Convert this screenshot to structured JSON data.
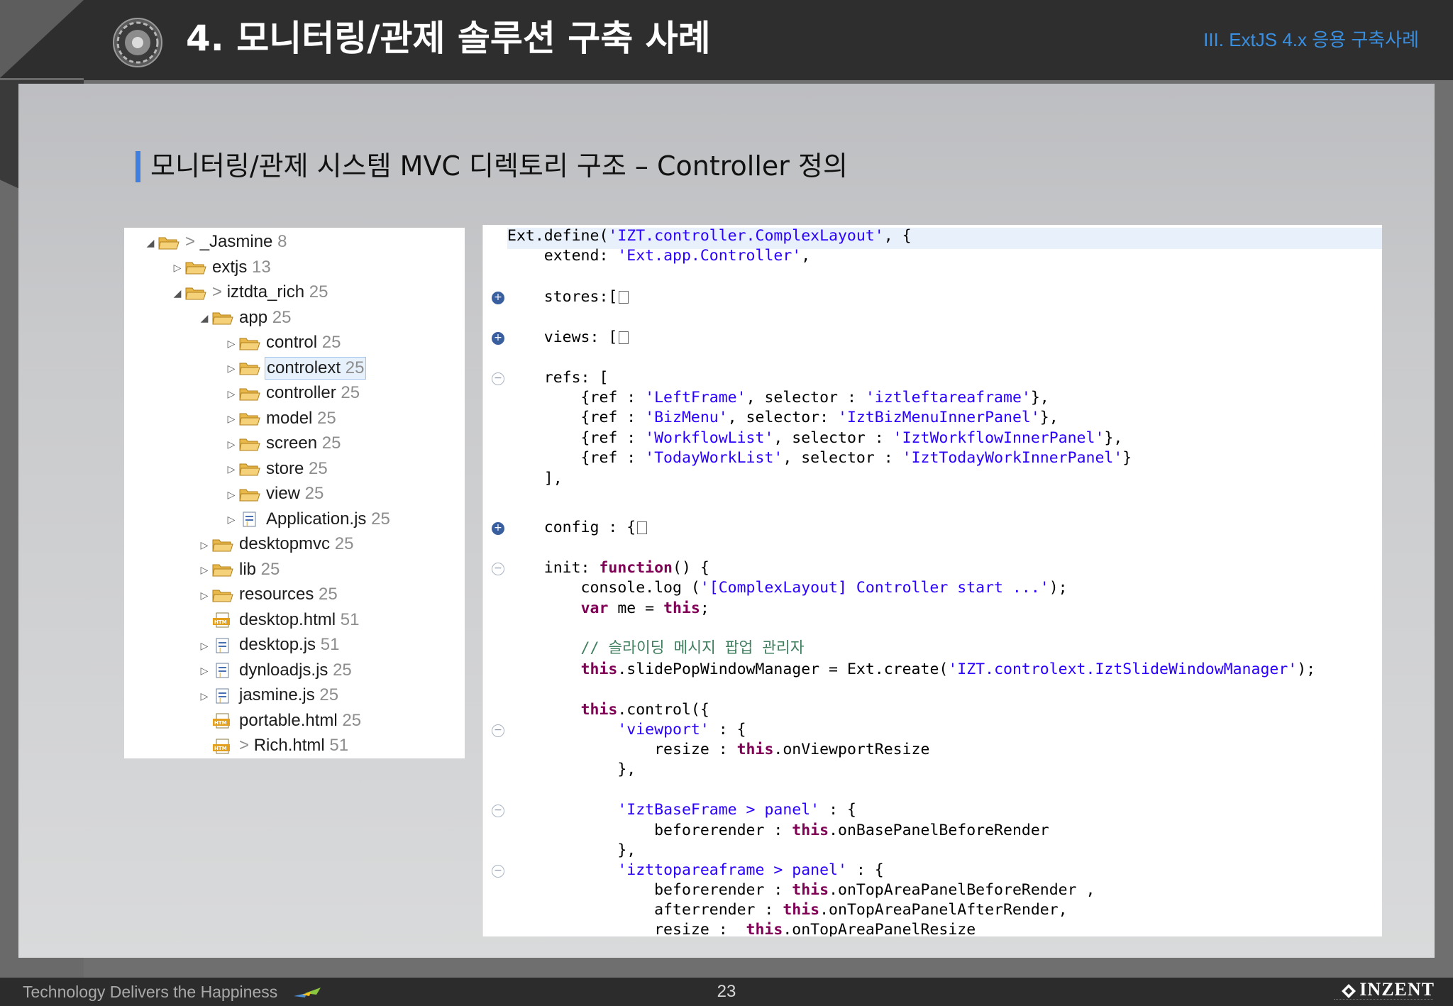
{
  "header": {
    "title": "4. 모니터링/관제 솔루션 구축 사례",
    "section": "III. ExtJS 4.x 응용 구축사례"
  },
  "subtitle": "모니터링/관제 시스템  MVC  디렉토리 구조  –  Controller 정의",
  "tree": {
    "items": [
      {
        "arrow": "◢",
        "prefix": "> ",
        "label": "_Jasmine",
        "count": "8",
        "icon": "project-folder-icon"
      },
      {
        "arrow": "▷",
        "prefix": "",
        "label": "extjs",
        "count": "13",
        "icon": "folder-icon"
      },
      {
        "arrow": "◢",
        "prefix": "> ",
        "label": "iztdta_rich",
        "count": "25",
        "icon": "folder-icon"
      },
      {
        "arrow": "◢",
        "prefix": "",
        "label": "app",
        "count": "25",
        "icon": "folder-icon"
      },
      {
        "arrow": "▷",
        "prefix": "",
        "label": "control",
        "count": "25",
        "icon": "folder-icon"
      },
      {
        "arrow": "▷",
        "prefix": "",
        "label": "controlext",
        "count": "25",
        "icon": "folder-icon",
        "selected": true
      },
      {
        "arrow": "▷",
        "prefix": "",
        "label": "controller",
        "count": "25",
        "icon": "folder-icon"
      },
      {
        "arrow": "▷",
        "prefix": "",
        "label": "model",
        "count": "25",
        "icon": "folder-icon"
      },
      {
        "arrow": "▷",
        "prefix": "",
        "label": "screen",
        "count": "25",
        "icon": "folder-icon"
      },
      {
        "arrow": "▷",
        "prefix": "",
        "label": "store",
        "count": "25",
        "icon": "folder-icon"
      },
      {
        "arrow": "▷",
        "prefix": "",
        "label": "view",
        "count": "25",
        "icon": "folder-icon"
      },
      {
        "arrow": "▷",
        "prefix": "",
        "label": "Application.js",
        "count": "25",
        "icon": "js-file-icon"
      },
      {
        "arrow": "▷",
        "prefix": "",
        "label": "desktopmvc",
        "count": "25",
        "icon": "folder-icon"
      },
      {
        "arrow": "▷",
        "prefix": "",
        "label": "lib",
        "count": "25",
        "icon": "folder-icon"
      },
      {
        "arrow": "▷",
        "prefix": "",
        "label": "resources",
        "count": "25",
        "icon": "folder-icon"
      },
      {
        "arrow": "",
        "prefix": "",
        "label": "desktop.html",
        "count": "51",
        "icon": "html-file-icon"
      },
      {
        "arrow": "▷",
        "prefix": "",
        "label": "desktop.js",
        "count": "51",
        "icon": "js-file-icon"
      },
      {
        "arrow": "▷",
        "prefix": "",
        "label": "dynloadjs.js",
        "count": "25",
        "icon": "js-file-icon"
      },
      {
        "arrow": "▷",
        "prefix": "",
        "label": "jasmine.js",
        "count": "25",
        "icon": "js-file-icon"
      },
      {
        "arrow": "",
        "prefix": "",
        "label": "portable.html",
        "count": "25",
        "icon": "html-file-icon"
      },
      {
        "arrow": "",
        "prefix": "> ",
        "label": "Rich.html",
        "count": "51",
        "icon": "html-file-icon"
      }
    ]
  },
  "code": {
    "lines": [
      [
        {
          "t": "Ext.define("
        },
        {
          "t": "'IZT.controller.ComplexLayout'",
          "c": "str"
        },
        {
          "t": ", {"
        }
      ],
      [
        {
          "t": "    extend: "
        },
        {
          "t": "'Ext.app.Controller'",
          "c": "str"
        },
        {
          "t": ","
        }
      ],
      [
        {
          "t": "    stores:["
        }
      ],
      [
        {
          "t": "    views: ["
        }
      ],
      [
        {
          "t": "    refs: ["
        }
      ],
      [
        {
          "t": "        {ref : "
        },
        {
          "t": "'LeftFrame'",
          "c": "str"
        },
        {
          "t": ", selector : "
        },
        {
          "t": "'iztleftareaframe'",
          "c": "str"
        },
        {
          "t": "},"
        }
      ],
      [
        {
          "t": "        {ref : "
        },
        {
          "t": "'BizMenu'",
          "c": "str"
        },
        {
          "t": ", selector: "
        },
        {
          "t": "'IztBizMenuInnerPanel'",
          "c": "str"
        },
        {
          "t": "},"
        }
      ],
      [
        {
          "t": "        {ref : "
        },
        {
          "t": "'WorkflowList'",
          "c": "str"
        },
        {
          "t": ", selector : "
        },
        {
          "t": "'IztWorkflowInnerPanel'",
          "c": "str"
        },
        {
          "t": "},"
        }
      ],
      [
        {
          "t": "        {ref : "
        },
        {
          "t": "'TodayWorkList'",
          "c": "str"
        },
        {
          "t": ", selector : "
        },
        {
          "t": "'IztTodayWorkInnerPanel'",
          "c": "str"
        },
        {
          "t": "}"
        }
      ],
      [
        {
          "t": "    ],"
        }
      ],
      [
        {
          "t": "    config : {"
        }
      ],
      [
        {
          "t": "    init: "
        },
        {
          "t": "function",
          "c": "kw"
        },
        {
          "t": "() {"
        }
      ],
      [
        {
          "t": "        console.log ("
        },
        {
          "t": "'[ComplexLayout] Controller start ...'",
          "c": "str"
        },
        {
          "t": ");"
        }
      ],
      [
        {
          "t": "        "
        },
        {
          "t": "var",
          "c": "kw"
        },
        {
          "t": " me = "
        },
        {
          "t": "this",
          "c": "kw"
        },
        {
          "t": ";"
        }
      ],
      [
        {
          "t": "        // 슬라이딩 메시지 팝업 관리자",
          "c": "cm"
        }
      ],
      [
        {
          "t": "        "
        },
        {
          "t": "this",
          "c": "kw"
        },
        {
          "t": ".slidePopWindowManager = Ext.create("
        },
        {
          "t": "'IZT.controlext.IztSlideWindowManager'",
          "c": "str"
        },
        {
          "t": ");"
        }
      ],
      [
        {
          "t": "        "
        },
        {
          "t": "this",
          "c": "kw"
        },
        {
          "t": ".control({"
        }
      ],
      [
        {
          "t": "            "
        },
        {
          "t": "'viewport'",
          "c": "str"
        },
        {
          "t": " : {"
        }
      ],
      [
        {
          "t": "                resize : "
        },
        {
          "t": "this",
          "c": "kw"
        },
        {
          "t": ".onViewportResize"
        }
      ],
      [
        {
          "t": "            },"
        }
      ],
      [
        {
          "t": "            "
        },
        {
          "t": "'IztBaseFrame > panel'",
          "c": "str"
        },
        {
          "t": " : {"
        }
      ],
      [
        {
          "t": "                beforerender : "
        },
        {
          "t": "this",
          "c": "kw"
        },
        {
          "t": ".onBasePanelBeforeRender"
        }
      ],
      [
        {
          "t": "            },"
        }
      ],
      [
        {
          "t": "            "
        },
        {
          "t": "'izttopareaframe > panel'",
          "c": "str"
        },
        {
          "t": " : {"
        }
      ],
      [
        {
          "t": "                beforerender : "
        },
        {
          "t": "this",
          "c": "kw"
        },
        {
          "t": ".onTopAreaPanelBeforeRender ,"
        }
      ],
      [
        {
          "t": "                afterrender : "
        },
        {
          "t": "this",
          "c": "kw"
        },
        {
          "t": ".onTopAreaPanelAfterRender,"
        }
      ],
      [
        {
          "t": "                resize :  "
        },
        {
          "t": "this",
          "c": "kw"
        },
        {
          "t": ".onTopAreaPanelResize"
        }
      ]
    ],
    "collapsed_lines": [
      2,
      3,
      10
    ],
    "fold_markers": [
      {
        "line": 2,
        "state": "plus"
      },
      {
        "line": 3,
        "state": "plus"
      },
      {
        "line": 4,
        "state": "minus"
      },
      {
        "line": 10,
        "state": "plus"
      },
      {
        "line": 11,
        "state": "minus"
      },
      {
        "line": 17,
        "state": "minus"
      },
      {
        "line": 20,
        "state": "minus"
      },
      {
        "line": 23,
        "state": "minus"
      }
    ]
  },
  "footer": {
    "tagline": "Technology Delivers the Happiness",
    "page": "23",
    "brand": "INZENT"
  },
  "colors": {
    "header_bg": "#2e2e2e",
    "section_blue": "#3a8fe0",
    "accent_bar": "#3e7fe0",
    "ribbon_yellow": "#f6c21b",
    "code_keyword": "#7f0055",
    "code_string": "#2a00ff",
    "code_comment": "#3f7f5f"
  }
}
